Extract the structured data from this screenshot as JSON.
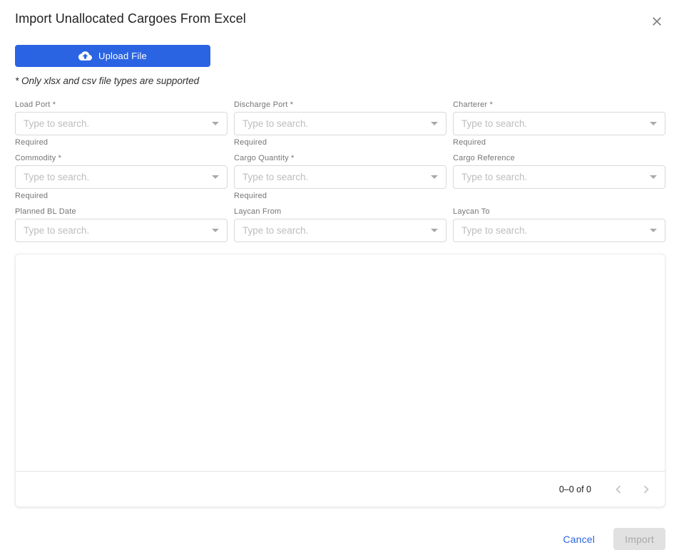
{
  "dialog": {
    "title": "Import Unallocated Cargoes From Excel"
  },
  "upload": {
    "button_label": "Upload File",
    "note": "* Only xlsx and csv file types are supported"
  },
  "form": {
    "placeholder": "Type to search.",
    "required_helper": "Required",
    "fields": [
      {
        "label": "Load Port *",
        "required": true
      },
      {
        "label": "Discharge Port *",
        "required": true
      },
      {
        "label": "Charterer *",
        "required": true
      },
      {
        "label": "Commodity *",
        "required": true
      },
      {
        "label": "Cargo Quantity *",
        "required": true
      },
      {
        "label": "Cargo Reference",
        "required": false
      },
      {
        "label": "Planned BL Date",
        "required": false
      },
      {
        "label": "Laycan From",
        "required": false
      },
      {
        "label": "Laycan To",
        "required": false
      }
    ]
  },
  "table": {
    "pagination": {
      "range_label": "0–0 of 0"
    }
  },
  "actions": {
    "cancel_label": "Cancel",
    "import_label": "Import"
  },
  "icons": {
    "upload_button": "cloud-upload-icon",
    "close": "close-icon",
    "field_dropdown": "chevron-down-icon",
    "pagination_prev": "chevron-left-icon",
    "pagination_next": "chevron-right-icon"
  },
  "colors": {
    "primary": "#2b64e3",
    "link": "#2b64e3",
    "disabled_button_bg": "#e1e1e1",
    "disabled_button_text": "#a8a8a8",
    "placeholder": "#bdbdbd",
    "label": "#757575",
    "border": "#d9d9d9"
  }
}
